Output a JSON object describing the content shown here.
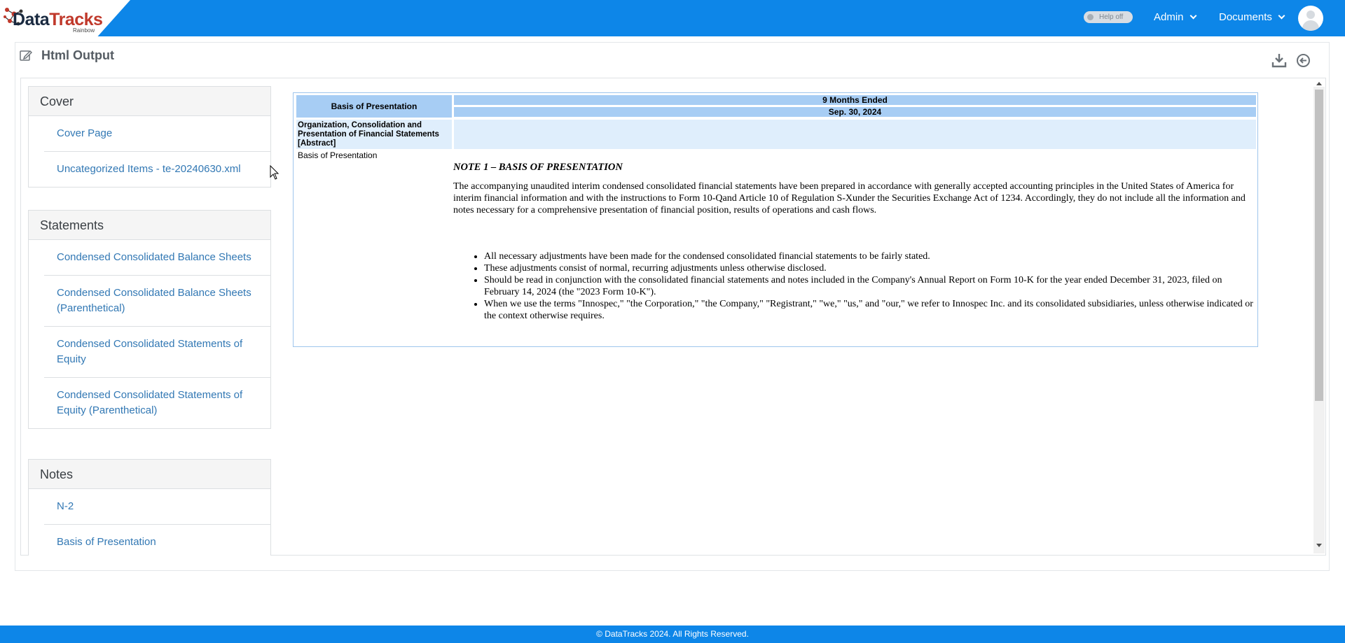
{
  "app": {
    "logo_main": "Data",
    "logo_accent": "Tracks",
    "logo_sub": "Rainbow",
    "help_toggle": "Help off",
    "nav_admin": "Admin",
    "nav_documents": "Documents"
  },
  "page": {
    "title": "Html Output"
  },
  "sidebar": {
    "groups": [
      {
        "title": "Cover",
        "items": [
          "Cover Page",
          "Uncategorized Items - te-20240630.xml"
        ]
      },
      {
        "title": "Statements",
        "items": [
          "Condensed Consolidated Balance Sheets",
          "Condensed Consolidated Balance Sheets (Parenthetical)",
          "Condensed Consolidated Statements of Equity",
          "Condensed Consolidated Statements of Equity (Parenthetical)"
        ]
      },
      {
        "title": "Notes",
        "items": [
          "N-2",
          "Basis of Presentation"
        ]
      }
    ]
  },
  "report": {
    "header_label": "Basis of Presentation",
    "period": "9 Months Ended",
    "date": "Sep. 30, 2024",
    "abstract_label": "Organization, Consolidation and Presentation of Financial Statements [Abstract]",
    "row_label": "Basis of Presentation",
    "note_title": "NOTE 1 – BASIS OF PRESENTATION",
    "note_paragraph": "The accompanying unaudited interim condensed consolidated financial statements have been prepared in accordance with generally accepted accounting principles in the United States of America for interim financial information and with the instructions to Form 10-Qand Article 10 of Regulation S-Xunder the Securities Exchange Act of 1234. Accordingly, they do not include all the information and notes necessary for a comprehensive presentation of financial position, results of operations and cash flows.",
    "bullets": [
      "All necessary adjustments have been made for the condensed consolidated financial statements to be fairly stated.",
      "These adjustments consist of normal, recurring adjustments unless otherwise disclosed.",
      " Should be read in conjunction with the consolidated financial statements and notes included in the Company's Annual Report on Form 10-K for the year ended December 31, 2023, filed on February 14, 2024 (the \"2023 Form 10-K\").",
      "When we use the terms \"Innospec,\" \"the Corporation,\" \"the Company,\" \"Registrant,\" \"we,\" \"us,\" and \"our,\" we refer to Innospec Inc. and its consolidated subsidiaries, unless otherwise indicated or the context otherwise requires."
    ]
  },
  "footer": {
    "text": "© DataTracks 2024. All Rights Reserved."
  },
  "colors": {
    "brand_blue": "#0d86e8",
    "link_blue": "#3278b4",
    "header_cell": "#a7cdf4",
    "abstract_row": "#dfeefc"
  },
  "icons": [
    "logo-network-icon",
    "edit-icon",
    "download-icon",
    "back-circle-icon",
    "user-avatar-icon",
    "chevron-down-icon",
    "mouse-cursor-icon"
  ]
}
